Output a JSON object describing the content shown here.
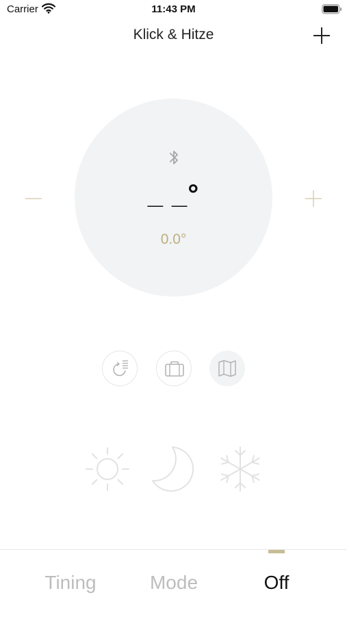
{
  "status_bar": {
    "carrier": "Carrier",
    "time": "11:43 PM"
  },
  "nav": {
    "title": "Klick & Hitze"
  },
  "dial": {
    "current_temp": "_ _°",
    "set_temp": "0.0°"
  },
  "tabs": [
    {
      "label": "Tining",
      "active": false
    },
    {
      "label": "Mode",
      "active": false
    },
    {
      "label": "Off",
      "active": true
    }
  ],
  "colors": {
    "accent": "#bfae7f",
    "dial_bg": "#f1f3f4",
    "inactive": "#bdbdbd"
  },
  "icons": [
    "wifi-icon",
    "battery-icon",
    "add-icon",
    "bluetooth-icon",
    "minus-icon",
    "plus-icon",
    "timer-list-icon",
    "briefcase-icon",
    "map-icon",
    "sun-icon",
    "moon-icon",
    "snowflake-icon"
  ]
}
